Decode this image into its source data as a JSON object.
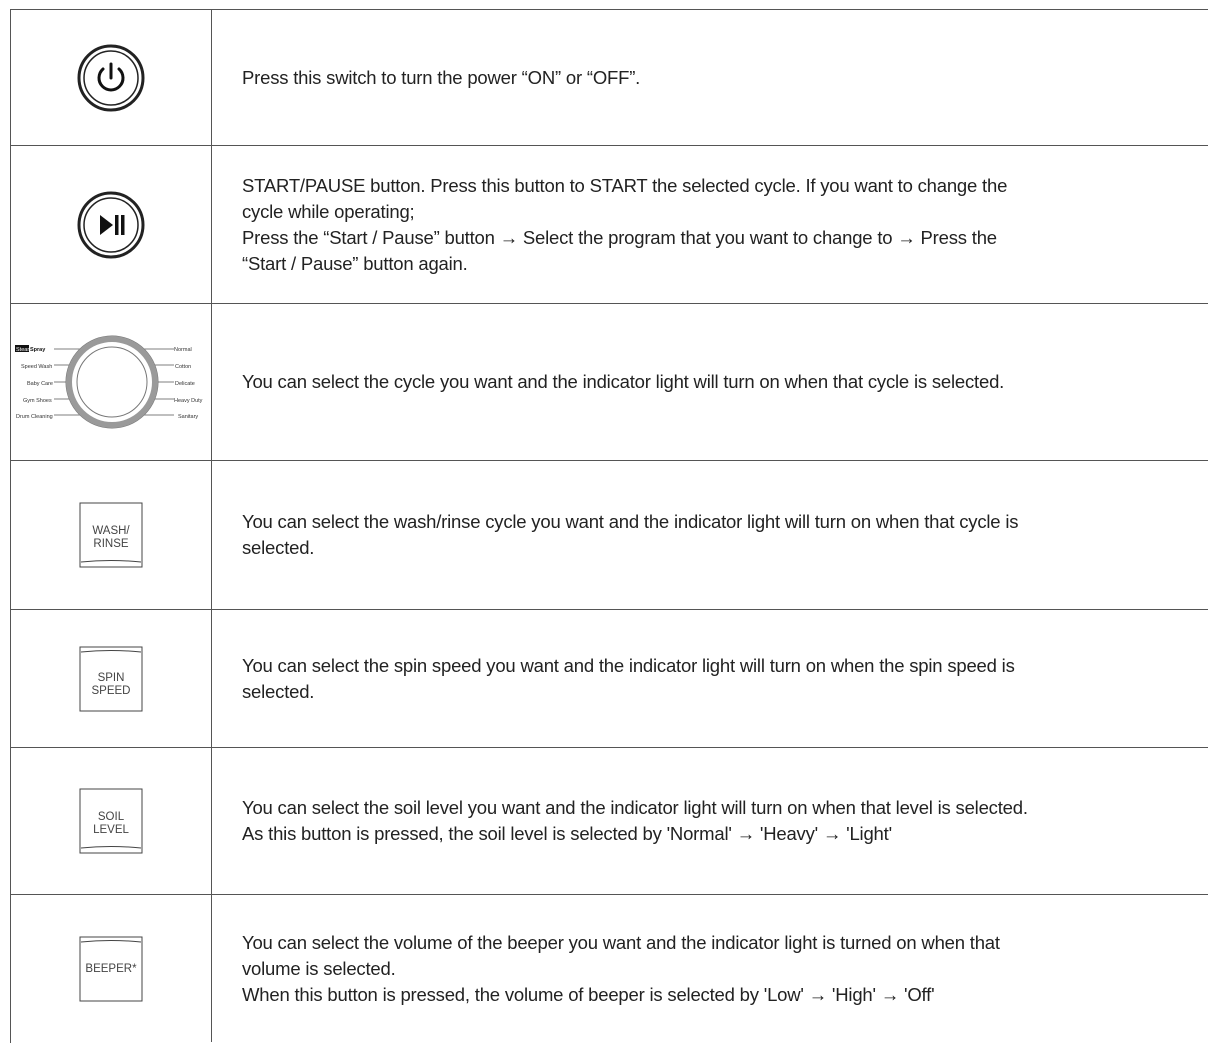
{
  "rows": [
    {
      "icon": "power-icon",
      "text": [
        "Press this switch to turn the power “ON” or “OFF”."
      ]
    },
    {
      "icon": "play-pause-icon",
      "text": [
        "START/PAUSE button. Press this button to START the selected cycle. If you want to change the",
        "cycle while operating;",
        "Press the “Start / Pause” button → Select the program that you want to change  to → Press the",
        "“Start / Pause” button again."
      ]
    },
    {
      "icon": "cycle-dial-icon",
      "dial": {
        "left_labels": [
          "Steam",
          "Spray",
          "Speed Wash",
          "Baby Care",
          "Gym Shoes",
          "Drum Cleaning"
        ],
        "right_labels": [
          "Normal",
          "Cotton",
          "Delicate",
          "Heavy Duty",
          "Sanitary"
        ]
      },
      "text": [
        "You can select the cycle you want and the indicator light will turn on when that cycle is selected."
      ]
    },
    {
      "icon": "wash-rinse-button-icon",
      "button_label": "WASH/\nRINSE",
      "text": [
        "You can select the wash/rinse cycle you want and the indicator light will turn on when that cycle is",
        "selected."
      ]
    },
    {
      "icon": "spin-speed-button-icon",
      "button_label": "SPIN\nSPEED",
      "text": [
        "You can select the spin speed you want and the indicator light will turn on when the spin speed is",
        "selected."
      ]
    },
    {
      "icon": "soil-level-button-icon",
      "button_label": "SOIL\nLEVEL",
      "text": [
        "You can select the soil level you want and the indicator light will turn on when that level is selected.",
        "As this button is pressed, the soil level is selected by 'Normal' → 'Heavy' → 'Light'"
      ]
    },
    {
      "icon": "beeper-button-icon",
      "button_label": "BEEPER*",
      "text": [
        "You can select the volume of the beeper you want and the indicator light is turned on when that",
        "volume is selected.",
        "When this button is pressed, the volume of beeper is selected by 'Low' → 'High' → 'Off'"
      ]
    }
  ]
}
